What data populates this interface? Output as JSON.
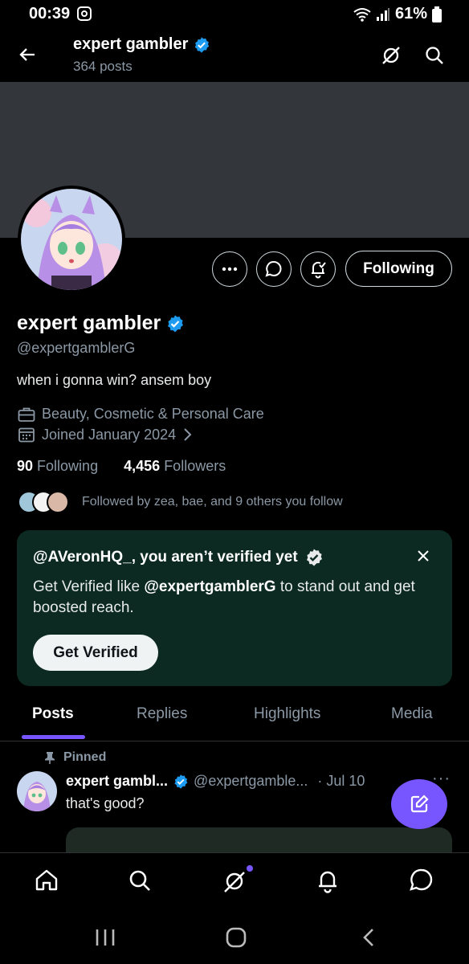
{
  "status_bar": {
    "time": "00:39",
    "battery": "61%"
  },
  "header": {
    "title": "expert gambler",
    "post_count": "364 posts"
  },
  "profile": {
    "name": "expert gambler",
    "handle": "@expertgamblerG",
    "bio": "when i gonna win? ansem boy",
    "category": "Beauty, Cosmetic & Personal Care",
    "joined": "Joined January 2024",
    "following_count": "90",
    "following_label": "Following",
    "followers_count": "4,456",
    "followers_label": "Followers",
    "followed_by": "Followed by zea, bae, and 9 others you follow",
    "following_button": "Following"
  },
  "verify_card": {
    "title": "@AVeronHQ_, you aren’t verified yet",
    "body_prefix": "Get Verified like ",
    "body_handle": "@expertgamblerG",
    "body_suffix": " to stand out and get boosted reach.",
    "button": "Get Verified"
  },
  "tabs": [
    "Posts",
    "Replies",
    "Highlights",
    "Media"
  ],
  "pinned_post": {
    "pinned_label": "Pinned",
    "author": "expert gambl...",
    "handle": "@expertgamble...",
    "date": "· Jul 10",
    "text": "that's good?"
  },
  "colors": {
    "accent": "#7856ff",
    "verified": "#1d9bf0",
    "card_bg": "#0c2a21",
    "banner": "#33373b"
  }
}
